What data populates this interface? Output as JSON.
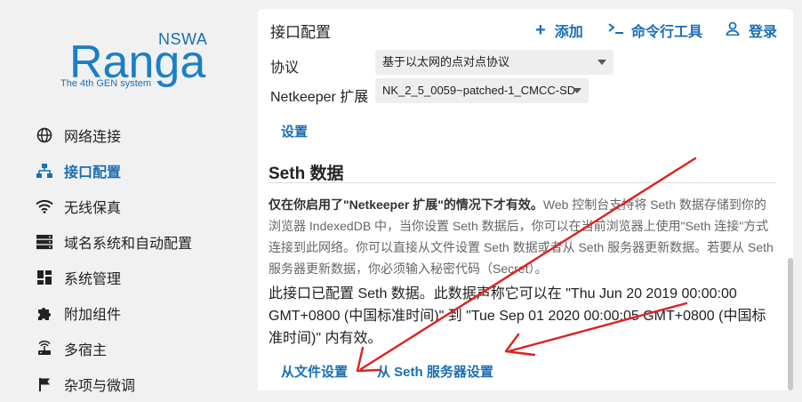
{
  "brand": {
    "name": "Ranga",
    "sub": "NSWA",
    "tagline": "The 4th GEN system"
  },
  "sidebar": {
    "items": [
      {
        "label": "网络连接",
        "icon": "globe-icon"
      },
      {
        "label": "接口配置",
        "icon": "network-tree-icon"
      },
      {
        "label": "无线保真",
        "icon": "wifi-icon"
      },
      {
        "label": "域名系统和自动配置",
        "icon": "server-icon"
      },
      {
        "label": "系统管理",
        "icon": "dashboard-icon"
      },
      {
        "label": "附加组件",
        "icon": "puzzle-icon"
      },
      {
        "label": "多宿主",
        "icon": "router-icon"
      },
      {
        "label": "杂项与微调",
        "icon": "flag-icon"
      }
    ]
  },
  "header": {
    "title": "接口配置",
    "add_label": "添加",
    "cli_label": "命令行工具",
    "login_label": "登录"
  },
  "form": {
    "protocol_label": "协议",
    "protocol_value": "基于以太网的点对点协议",
    "netkeeper_label": "Netkeeper 扩展",
    "netkeeper_value": "NK_2_5_0059~patched-1_CMCC-SD",
    "settings_link": "设置"
  },
  "seth": {
    "heading": "Seth 数据",
    "desc_bold": "仅在你启用了\"Netkeeper 扩展\"的情况下才有效。",
    "desc_rest": "Web 控制台支持将 Seth 数据存储到你的浏览器 IndexedDB 中，当你设置 Seth 数据后，你可以在当前浏览器上使用\"Seth 连接\"方式连接到此网络。你可以直接从文件设置 Seth 数据或者从 Seth 服务器更新数据。若要从 Seth 服务器更新数据，你必须输入秘密代码（Secret）。",
    "info": "此接口已配置 Seth 数据。此数据声称它可以在 \"Thu Jun 20 2019 00:00:00 GMT+0800 (中国标准时间)\" 到 \"Tue Sep 01 2020 00:00:05 GMT+0800 (中国标准时间)\" 内有效。",
    "from_file": "从文件设置",
    "from_server": "从 Seth 服务器设置"
  },
  "colors": {
    "accent": "#1a6fb5",
    "arrow": "#e02020"
  }
}
